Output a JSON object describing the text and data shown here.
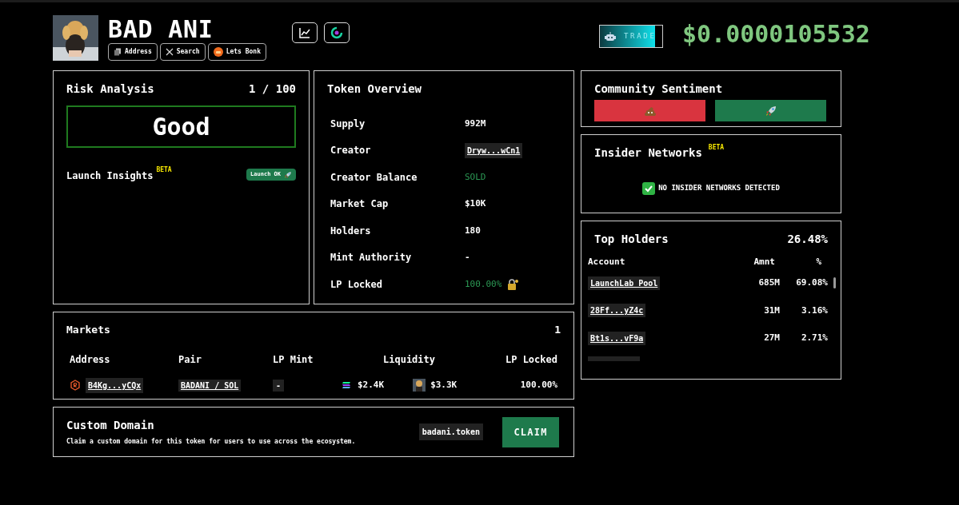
{
  "token": {
    "name": "BAD ANI",
    "links": [
      {
        "kind": "address",
        "label": "Address"
      },
      {
        "kind": "x",
        "label": "Search"
      },
      {
        "kind": "bonk",
        "label": "Lets Bonk"
      }
    ]
  },
  "trade_button": {
    "label": "TRADE"
  },
  "price": "$0.0000105532",
  "risk": {
    "title": "Risk Analysis",
    "score": "1 / 100",
    "verdict": "Good",
    "insights_label": "Launch Insights",
    "beta": "BETA",
    "badge": "Launch OK"
  },
  "overview": {
    "title": "Token Overview",
    "rows": [
      {
        "label": "Supply",
        "value": "992M",
        "kind": "plain"
      },
      {
        "label": "Creator",
        "value": "Dryw...wCn1",
        "kind": "address"
      },
      {
        "label": "Creator Balance",
        "value": "SOLD",
        "kind": "good"
      },
      {
        "label": "Market Cap",
        "value": "$10K",
        "kind": "plain"
      },
      {
        "label": "Holders",
        "value": "180",
        "kind": "plain"
      },
      {
        "label": "Mint Authority",
        "value": "-",
        "kind": "plain"
      },
      {
        "label": "LP Locked",
        "value": "100.00%",
        "kind": "locked"
      }
    ]
  },
  "sentiment": {
    "title": "Community Sentiment"
  },
  "insiders": {
    "title": "Insider Networks",
    "beta": "BETA",
    "status": "NO INSIDER NETWORKS DETECTED"
  },
  "top_holders": {
    "title": "Top Holders",
    "total": "26.48%",
    "columns": [
      "Account",
      "Amnt",
      "%"
    ],
    "rows": [
      {
        "account": "LaunchLab Pool",
        "amount": "685M",
        "percent": "69.08%"
      },
      {
        "account": "28Ff...yZ4c",
        "amount": "31M",
        "percent": "3.16%"
      },
      {
        "account": "Bt1s...vF9a",
        "amount": "27M",
        "percent": "2.71%"
      }
    ]
  },
  "markets": {
    "title": "Markets",
    "count": "1",
    "columns": [
      "Address",
      "Pair",
      "LP Mint",
      "Liquidity",
      "LP Locked"
    ],
    "rows": [
      {
        "address": "B4Kg...yCQx",
        "pair": "BADANI / SOL",
        "lp_mint": "-",
        "liquidity_quote": "$2.4K",
        "liquidity_base": "$3.3K",
        "lp_locked": "100.00%"
      }
    ]
  },
  "custom_domain": {
    "title": "Custom Domain",
    "description": "Claim a custom domain for this token for users to use across the ecosystem.",
    "domain": "badani.token",
    "button": "CLAIM"
  }
}
